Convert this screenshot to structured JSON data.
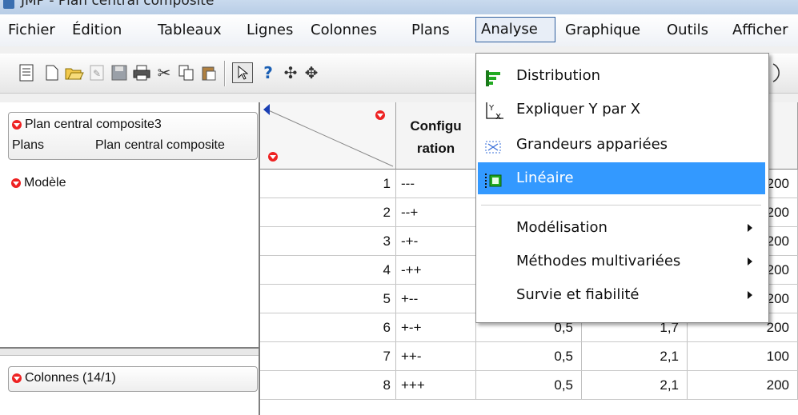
{
  "window": {
    "title": "JMP - Plan central composite"
  },
  "menubar": [
    "Fichier",
    "Édition",
    "Tableaux",
    "Lignes",
    "Colonnes",
    "Plans",
    "Analyse",
    "Graphique",
    "Outils",
    "Afficher"
  ],
  "toolbar": {
    "icons": [
      "report-icon",
      "new-icon",
      "open-icon",
      "edit-icon",
      "save-icon",
      "print-icon",
      "cut-icon",
      "copy-icon",
      "paste-icon",
      "arrow-icon",
      "help-icon",
      "crosshair-icon",
      "move-icon"
    ]
  },
  "left_panel": {
    "table_name": "Plan central composite3",
    "plans_label": "Plans",
    "plans_value": "Plan central composite",
    "model_label": "Modèle",
    "columns_label": "Colonnes (14/1)"
  },
  "grid": {
    "col_header": "Configu\nration",
    "col_header_l1": "Configu",
    "col_header_l2": "ration",
    "rows": [
      {
        "n": "1",
        "config": "---",
        "a": "",
        "b": "",
        "c": "200"
      },
      {
        "n": "2",
        "config": "--+",
        "a": "",
        "b": "",
        "c": "200"
      },
      {
        "n": "3",
        "config": "-+-",
        "a": "",
        "b": "",
        "c": "200"
      },
      {
        "n": "4",
        "config": "-++",
        "a": "",
        "b": "",
        "c": "200"
      },
      {
        "n": "5",
        "config": "+--",
        "a": "",
        "b": "",
        "c": "200"
      },
      {
        "n": "6",
        "config": "+-+",
        "a": "0,5",
        "b": "1,7",
        "c": "200"
      },
      {
        "n": "7",
        "config": "++-",
        "a": "0,5",
        "b": "2,1",
        "c": "100"
      },
      {
        "n": "8",
        "config": "+++",
        "a": "0,5",
        "b": "2,1",
        "c": "200"
      }
    ]
  },
  "analyse_menu": {
    "items": [
      {
        "label": "Distribution",
        "icon": "distribution-icon"
      },
      {
        "label": "Expliquer Y par X",
        "icon": "fit-y-by-x-icon"
      },
      {
        "label": "Grandeurs appariées",
        "icon": "matched-pairs-icon"
      },
      {
        "label": "Linéaire",
        "icon": "linear-model-icon"
      },
      {
        "label": "Modélisation",
        "submenu": true
      },
      {
        "label": "Méthodes multivariées",
        "submenu": true
      },
      {
        "label": "Survie et fiabilité",
        "submenu": true
      }
    ]
  }
}
